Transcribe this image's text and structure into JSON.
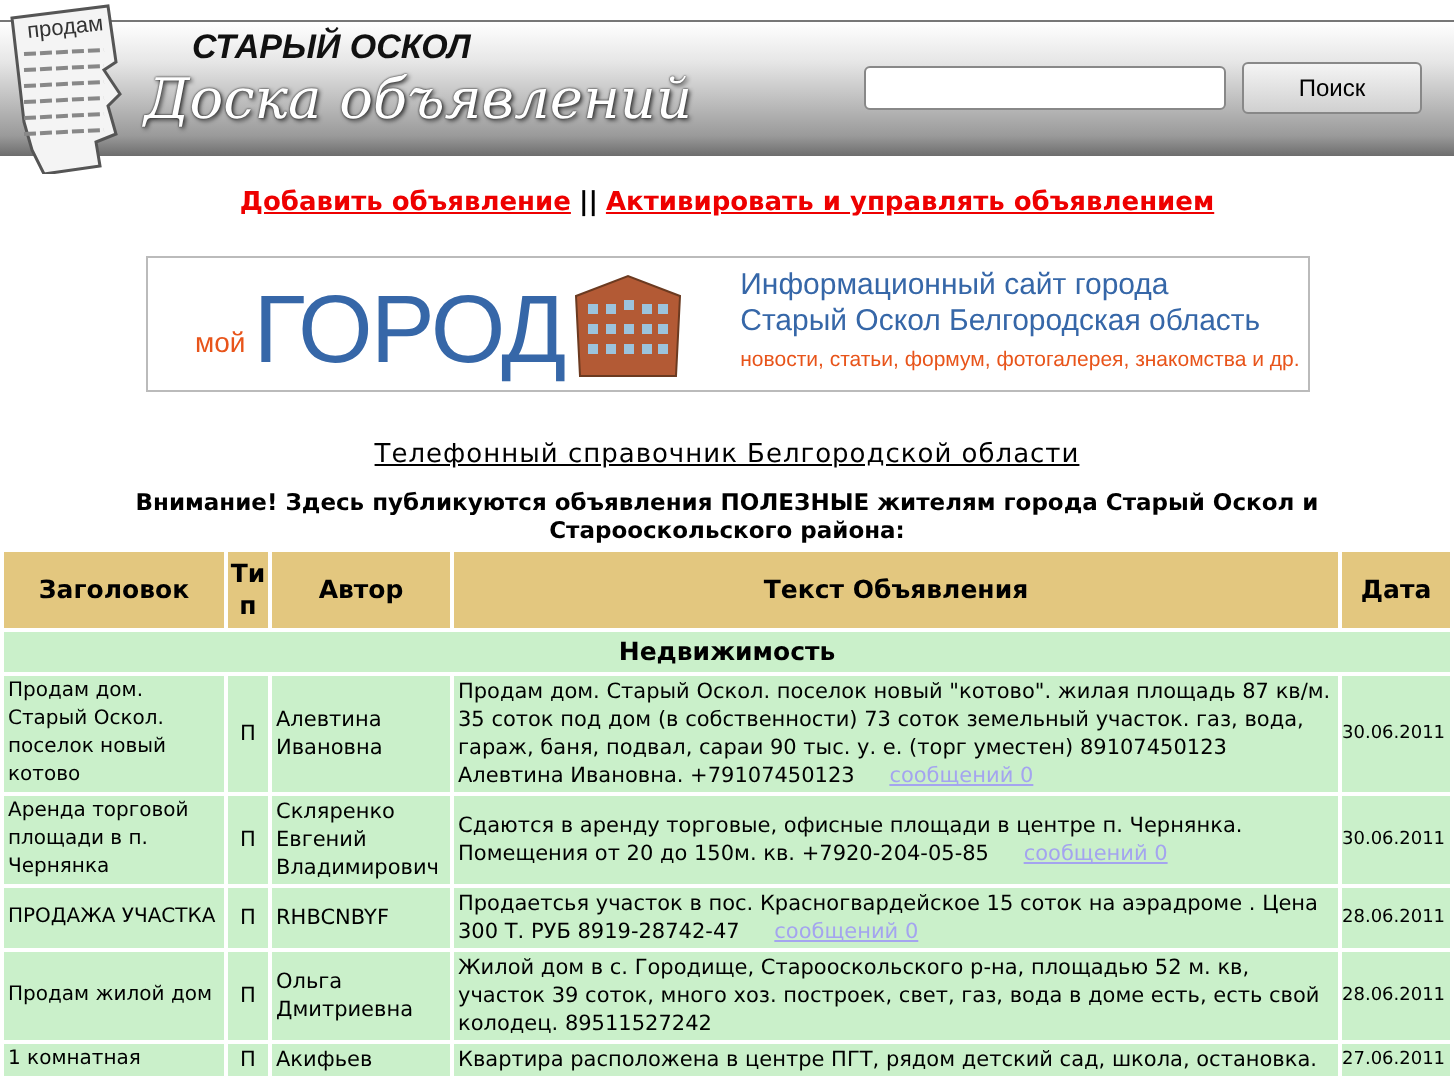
{
  "header": {
    "logo_paper_text": "продам",
    "city": "СТАРЫЙ ОСКОЛ",
    "site_title": "Доска объявлений",
    "search": {
      "button": "Поиск"
    }
  },
  "links": [
    {
      "label": "Добавить объявление"
    },
    {
      "label": "Активировать и управлять объявлением"
    }
  ],
  "link_separator": "||",
  "banner": {
    "small": "мой",
    "big": "ГОРОД",
    "line1": "Информационный сайт города",
    "line2": "Старый Оскол Белгородская область",
    "line3": "новости, статьи, формум, фотогалерея, знакомства и др."
  },
  "directory_link": "Телефонный справочник Белгородской области",
  "notice": "Внимание! Здесь публикуются объявления ПОЛЕЗНЫЕ жителям города Старый Оскол и Старооскольского района:",
  "table": {
    "columns": [
      "Заголовок",
      "Тип",
      "Автор",
      "Текст Объявления",
      "Дата"
    ],
    "section": "Недвижимость",
    "rows": [
      {
        "title": "Продам дом. Старый Оскол. поселок новый котово",
        "type": "П",
        "author": "Алевтина Ивановна",
        "text": "Продам дом. Старый Оскол. поселок новый \"котово\". жилая площадь 87 кв/м. 35 соток под дом (в собственности) 73 соток земельный участок. газ, вода, гараж, баня, подвал, сараи 90 тыс. у. е. (торг уместен) 89107450123 Алевтина Ивановна. +79107450123",
        "messages": "сообщений 0",
        "date": "30.06.2011"
      },
      {
        "title": "Аренда торговой площади в п. Чернянка",
        "type": "П",
        "author": "Скляренко Евгений Владимирович",
        "text": "Сдаются в аренду торговые, офисные площади в центре п. Чернянка. Помещения от 20 до 150м. кв. +7920-204-05-85",
        "messages": "сообщений 0",
        "date": "30.06.2011"
      },
      {
        "title": "ПРОДАЖА УЧАСТКА",
        "type": "П",
        "author": "RHBCNBYF",
        "text": "Продаетсья участок в пос. Красногвардейское 15 соток на аэрадроме . Цена 300 Т. РУБ 8919-28742-47",
        "messages": "сообщений 0",
        "date": "28.06.2011"
      },
      {
        "title": "Продам жилой дом",
        "type": "П",
        "author": "Ольга Дмитриевна",
        "text": "Жилой дом в с. Городище, Старооскольского р-на, площадью 52 м. кв, участок 39 соток, много хоз. построек, свет, газ, вода в доме есть, есть свой колодец. 89511527242",
        "date": "28.06.2011"
      },
      {
        "title": "1 комнатная",
        "type": "П",
        "author": "Акифьев",
        "text": "Квартира расположена в центре ПГТ, рядом детский сад, школа, остановка.",
        "date": "27.06.2011"
      }
    ]
  }
}
